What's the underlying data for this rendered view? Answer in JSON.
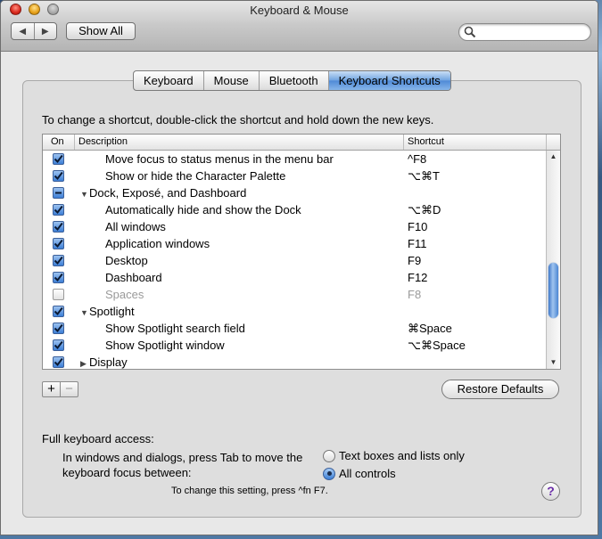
{
  "window": {
    "title": "Keyboard & Mouse"
  },
  "toolbar": {
    "back_icon": "triangle-left",
    "forward_icon": "triangle-right",
    "show_all_label": "Show All",
    "search_placeholder": "",
    "search_value": ""
  },
  "tabs": [
    {
      "label": "Keyboard",
      "active": false
    },
    {
      "label": "Mouse",
      "active": false
    },
    {
      "label": "Bluetooth",
      "active": false
    },
    {
      "label": "Keyboard Shortcuts",
      "active": true
    }
  ],
  "instructions": "To change a shortcut, double-click the shortcut and hold down the new keys.",
  "table": {
    "columns": {
      "on": "On",
      "description": "Description",
      "shortcut": "Shortcut"
    },
    "rows": [
      {
        "state": "checked",
        "description": "Move focus to status menus in the menu bar",
        "shortcut": "^F8"
      },
      {
        "state": "checked",
        "description": "Show or hide the Character Palette",
        "shortcut": "⌥⌘T"
      },
      {
        "state": "mixed",
        "group": true,
        "expanded": true,
        "description": "Dock, Exposé, and Dashboard",
        "shortcut": ""
      },
      {
        "state": "checked",
        "description": "Automatically hide and show the Dock",
        "shortcut": "⌥⌘D"
      },
      {
        "state": "checked",
        "description": "All windows",
        "shortcut": "F10"
      },
      {
        "state": "checked",
        "description": "Application windows",
        "shortcut": "F11"
      },
      {
        "state": "checked",
        "description": "Desktop",
        "shortcut": "F9"
      },
      {
        "state": "checked",
        "description": "Dashboard",
        "shortcut": "F12"
      },
      {
        "state": "unchecked",
        "disabled": true,
        "description": "Spaces",
        "shortcut": "F8"
      },
      {
        "state": "checked",
        "group": true,
        "expanded": true,
        "description": "Spotlight",
        "shortcut": ""
      },
      {
        "state": "checked",
        "description": "Show Spotlight search field",
        "shortcut": "⌘Space"
      },
      {
        "state": "checked",
        "description": "Show Spotlight window",
        "shortcut": "⌥⌘Space"
      },
      {
        "state": "checked",
        "group": true,
        "expanded": false,
        "description": "Display",
        "shortcut": ""
      }
    ],
    "scroll_position": 0.72
  },
  "buttons": {
    "add": "+",
    "remove": "−",
    "restore_defaults": "Restore Defaults",
    "help": "?"
  },
  "keyboard_access": {
    "label": "Full keyboard access:",
    "help_text": "In windows and dialogs, press Tab to move the keyboard focus between:",
    "options": [
      {
        "label": "Text boxes and lists only",
        "selected": false
      },
      {
        "label": "All controls",
        "selected": true
      }
    ],
    "note": "To change this setting, press ^fn F7."
  }
}
